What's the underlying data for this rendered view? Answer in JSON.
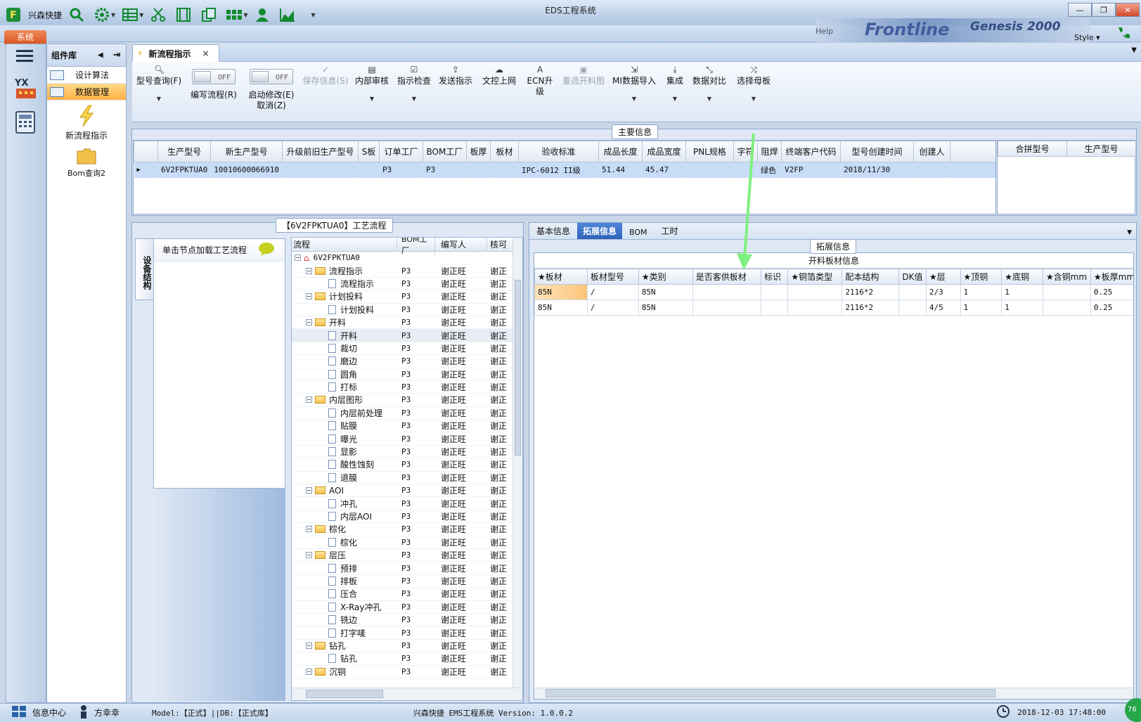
{
  "window": {
    "title": "EDS工程系统",
    "brand": "兴森快捷",
    "style_label": "Style",
    "menu_system": "系统",
    "banner_text": "Frontline",
    "banner_text2": "Genesis 2000",
    "help_label": "Help"
  },
  "sidebar": {
    "header": "组件库",
    "items": [
      {
        "label": "设计算法"
      },
      {
        "label": "数据管理"
      }
    ],
    "big_items": [
      {
        "label": "新流程指示"
      },
      {
        "label": "Bom查询2"
      }
    ]
  },
  "doc_tab": {
    "label": "新流程指示",
    "close": "×"
  },
  "ribbon": {
    "b1": {
      "label": "型号查询(F)"
    },
    "b2": {
      "label": "编写流程(R)",
      "toggle": "OFF"
    },
    "b3": {
      "label": "启动修改(E)",
      "sub": "取消(Z)",
      "toggle": "OFF"
    },
    "b4": {
      "label": "保存信息(S)"
    },
    "b5": {
      "label": "内部审核"
    },
    "b6": {
      "label": "指示检查"
    },
    "b7": {
      "label": "发送指示"
    },
    "b8": {
      "label": "文控上网"
    },
    "b9": {
      "label": "ECN升级"
    },
    "b10": {
      "label": "重选开料图"
    },
    "b11": {
      "label": "MI数据导入"
    },
    "b12": {
      "label": "集成"
    },
    "b13": {
      "label": "数据对比"
    },
    "b14": {
      "label": "选择母板"
    }
  },
  "main_info": {
    "caption": "主要信息",
    "columns": [
      "生产型号",
      "新生产型号",
      "升级前旧生产型号",
      "S板",
      "订单工厂",
      "BOM工厂",
      "板厚",
      "板材",
      "验收标准",
      "成品长度",
      "成品宽度",
      "PNL规格",
      "字符",
      "阻焊",
      "终端客户代码",
      "型号创建时间",
      "创建人"
    ],
    "row": [
      "6V2FPKTUA0",
      "10010600066910",
      "",
      "",
      "P3",
      "P3",
      "",
      "",
      "IPC-6012 II级",
      "51.44",
      "45.47",
      "",
      "",
      "绿色",
      "V2FP",
      "2018/11/30",
      ""
    ],
    "side_columns": [
      "合拼型号",
      "生产型号"
    ]
  },
  "process": {
    "caption": "【6V2FPKTUA0】工艺流程",
    "side_tab": "设备结构",
    "hint": "单击节点加载工艺流程",
    "columns": [
      "流程",
      "BOM工厂",
      "编写人",
      "核可"
    ],
    "root": "6V2FPKTUA0",
    "rows": [
      {
        "name": "流程指示",
        "type": "folder",
        "f": "P3",
        "w": "谢正旺",
        "c": "谢正"
      },
      {
        "name": "流程指示",
        "type": "doc",
        "f": "P3",
        "w": "谢正旺",
        "c": "谢正"
      },
      {
        "name": "计划投料",
        "type": "folder",
        "f": "P3",
        "w": "谢正旺",
        "c": "谢正"
      },
      {
        "name": "计划投料",
        "type": "doc",
        "f": "P3",
        "w": "谢正旺",
        "c": "谢正"
      },
      {
        "name": "开料",
        "type": "folder",
        "f": "P3",
        "w": "谢正旺",
        "c": "谢正"
      },
      {
        "name": "开料",
        "type": "doc",
        "f": "P3",
        "w": "谢正旺",
        "c": "谢正"
      },
      {
        "name": "裁切",
        "type": "doc",
        "f": "P3",
        "w": "谢正旺",
        "c": "谢正"
      },
      {
        "name": "磨边",
        "type": "doc",
        "f": "P3",
        "w": "谢正旺",
        "c": "谢正"
      },
      {
        "name": "圆角",
        "type": "doc",
        "f": "P3",
        "w": "谢正旺",
        "c": "谢正"
      },
      {
        "name": "打标",
        "type": "doc",
        "f": "P3",
        "w": "谢正旺",
        "c": "谢正"
      },
      {
        "name": "内层图形",
        "type": "folder",
        "f": "P3",
        "w": "谢正旺",
        "c": "谢正"
      },
      {
        "name": "内层前处理",
        "type": "doc",
        "f": "P3",
        "w": "谢正旺",
        "c": "谢正"
      },
      {
        "name": "贴膜",
        "type": "doc",
        "f": "P3",
        "w": "谢正旺",
        "c": "谢正"
      },
      {
        "name": "曝光",
        "type": "doc",
        "f": "P3",
        "w": "谢正旺",
        "c": "谢正"
      },
      {
        "name": "显影",
        "type": "doc",
        "f": "P3",
        "w": "谢正旺",
        "c": "谢正"
      },
      {
        "name": "酸性蚀刻",
        "type": "doc",
        "f": "P3",
        "w": "谢正旺",
        "c": "谢正"
      },
      {
        "name": "退膜",
        "type": "doc",
        "f": "P3",
        "w": "谢正旺",
        "c": "谢正"
      },
      {
        "name": "AOI",
        "type": "folder",
        "f": "P3",
        "w": "谢正旺",
        "c": "谢正"
      },
      {
        "name": "冲孔",
        "type": "doc",
        "f": "P3",
        "w": "谢正旺",
        "c": "谢正"
      },
      {
        "name": "内层AOI",
        "type": "doc",
        "f": "P3",
        "w": "谢正旺",
        "c": "谢正"
      },
      {
        "name": "棕化",
        "type": "folder",
        "f": "P3",
        "w": "谢正旺",
        "c": "谢正"
      },
      {
        "name": "棕化",
        "type": "doc",
        "f": "P3",
        "w": "谢正旺",
        "c": "谢正"
      },
      {
        "name": "层压",
        "type": "folder",
        "f": "P3",
        "w": "谢正旺",
        "c": "谢正"
      },
      {
        "name": "预排",
        "type": "doc",
        "f": "P3",
        "w": "谢正旺",
        "c": "谢正"
      },
      {
        "name": "排板",
        "type": "doc",
        "f": "P3",
        "w": "谢正旺",
        "c": "谢正"
      },
      {
        "name": "压合",
        "type": "doc",
        "f": "P3",
        "w": "谢正旺",
        "c": "谢正"
      },
      {
        "name": "X-Ray冲孔",
        "type": "doc",
        "f": "P3",
        "w": "谢正旺",
        "c": "谢正"
      },
      {
        "name": "铣边",
        "type": "doc",
        "f": "P3",
        "w": "谢正旺",
        "c": "谢正"
      },
      {
        "name": "打字唛",
        "type": "doc",
        "f": "P3",
        "w": "谢正旺",
        "c": "谢正"
      },
      {
        "name": "钻孔",
        "type": "folder",
        "f": "P3",
        "w": "谢正旺",
        "c": "谢正"
      },
      {
        "name": "钻孔",
        "type": "doc",
        "f": "P3",
        "w": "谢正旺",
        "c": "谢正"
      },
      {
        "name": "沉铜",
        "type": "folder",
        "f": "P3",
        "w": "谢正旺",
        "c": "谢正"
      }
    ]
  },
  "detail_tabs": [
    "基本信息",
    "拓展信息",
    "BOM",
    "工时"
  ],
  "ext": {
    "caption": "拓展信息",
    "title": "开料板材信息",
    "columns": [
      "★板材",
      "板材型号",
      "★类别",
      "是否客供板材",
      "标识",
      "★铜箔类型",
      "配本结构",
      "DK值",
      "★层",
      "★顶铜",
      "★底铜",
      "★含铜mm",
      "★板厚mm"
    ],
    "rows": [
      [
        "85N",
        "/",
        "85N",
        "",
        "",
        "",
        "2116*2",
        "",
        "2/3",
        "1",
        "1",
        "",
        "0.25"
      ],
      [
        "85N",
        "/",
        "85N",
        "",
        "",
        "",
        "2116*2",
        "",
        "4/5",
        "1",
        "1",
        "",
        "0.25"
      ]
    ]
  },
  "status": {
    "center": "信息中心",
    "user": "方幸幸",
    "model": "Model:【正式】||DB:【正式库】",
    "app": "兴森快捷 EMS工程系统 Version: 1.0.0.2",
    "datetime": "2018-12-03 17:48:00",
    "badge": "76"
  },
  "colors": {
    "accent": "#fbb244",
    "selection": "#c6dcf7",
    "arrow": "#7ff07f"
  }
}
